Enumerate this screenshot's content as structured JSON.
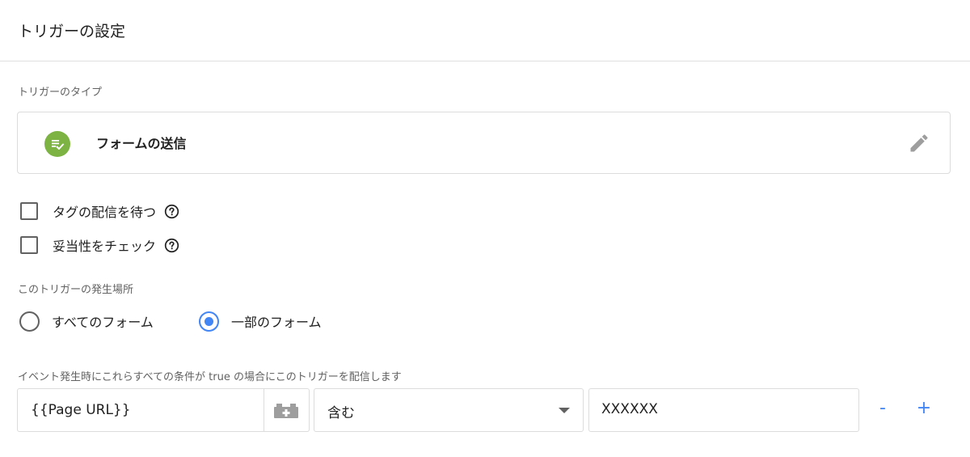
{
  "header": {
    "title": "トリガーの設定"
  },
  "trigger_type": {
    "label": "トリガーのタイプ",
    "name": "フォームの送信",
    "icon": "form-check-icon",
    "icon_color": "#7cb342"
  },
  "options": {
    "wait_for_tags": {
      "label": "タグの配信を待つ",
      "checked": false
    },
    "check_validation": {
      "label": "妥当性をチェック",
      "checked": false
    }
  },
  "fire_on": {
    "label": "このトリガーの発生場所",
    "all_forms": {
      "label": "すべてのフォーム",
      "selected": false
    },
    "some_forms": {
      "label": "一部のフォーム",
      "selected": true
    }
  },
  "conditions": {
    "label": "イベント発生時にこれらすべての条件が true の場合にこのトリガーを配信します",
    "rows": [
      {
        "variable": "{{Page URL}}",
        "operator": "含む",
        "value": "XXXXXX"
      }
    ],
    "remove_label": "-",
    "add_label": "+"
  },
  "colors": {
    "accent": "#4285f4",
    "border": "#dcdcdc",
    "text": "#212121",
    "muted": "#616161"
  }
}
